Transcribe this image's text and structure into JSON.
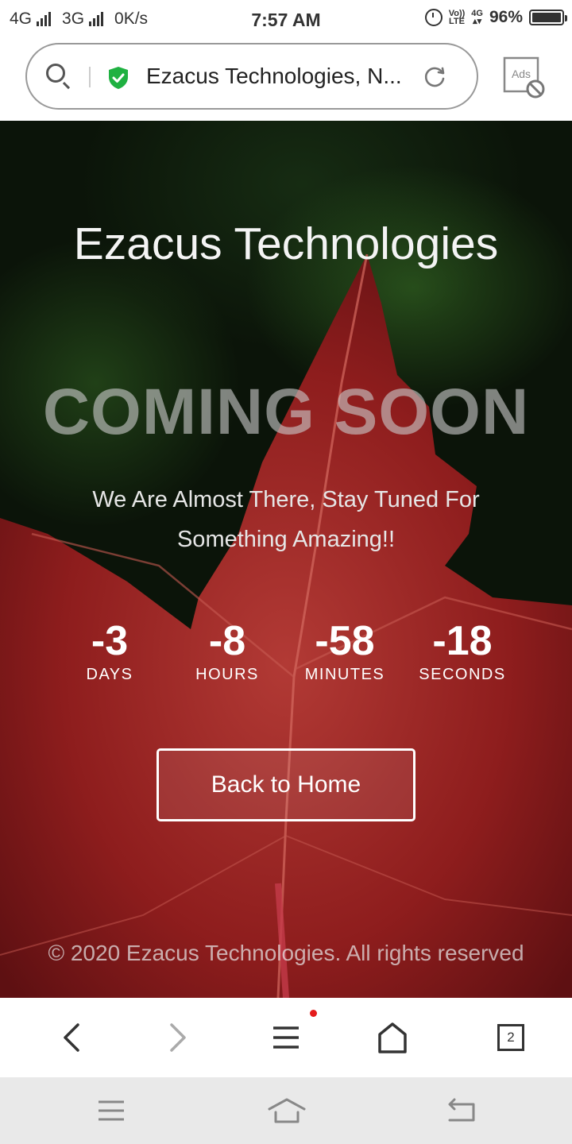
{
  "status_bar": {
    "network_1": "4G",
    "network_2": "3G",
    "speed": "0K/s",
    "time": "7:57 AM",
    "volte_top": "Vo))",
    "volte_bottom": "LTE",
    "net_small": "4G",
    "battery": "96%"
  },
  "browser": {
    "url_text": "Ezacus Technologies, N...",
    "ads_label": "Ads",
    "tabs_count": "2"
  },
  "page": {
    "site_title": "Ezacus Technologies",
    "headline": "COMING SOON",
    "tagline": "We Are Almost There, Stay Tuned For Something Amazing!!",
    "countdown": [
      {
        "value": "-3",
        "label": "DAYS"
      },
      {
        "value": "-8",
        "label": "HOURS"
      },
      {
        "value": "-58",
        "label": "MINUTES"
      },
      {
        "value": "-18",
        "label": "SECONDS"
      }
    ],
    "button_label": "Back to Home",
    "copyright": "© 2020 Ezacus Technologies. All rights reserved"
  },
  "colors": {
    "shield_green": "#1fb141",
    "leaf_red": "#8e1d1d",
    "menu_dot": "#e41b1b"
  }
}
